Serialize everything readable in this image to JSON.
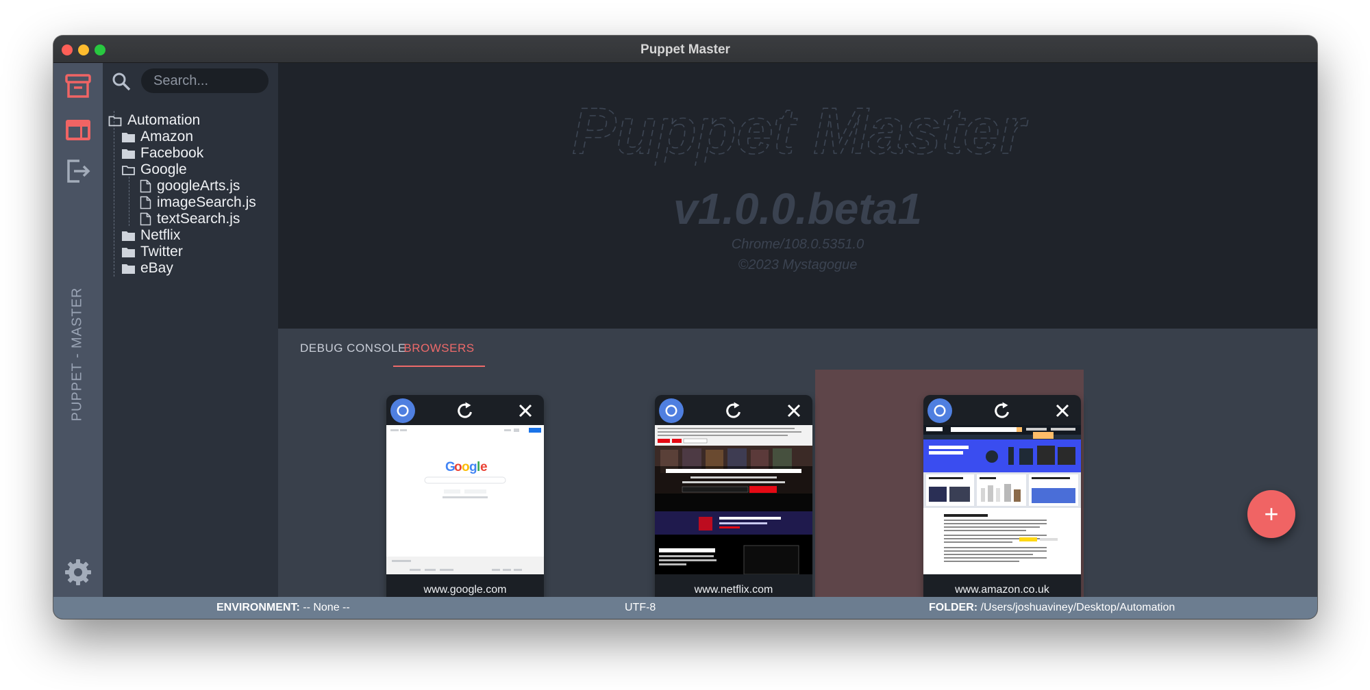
{
  "window": {
    "title": "Puppet Master"
  },
  "activity_bar": {
    "items": [
      {
        "icon": "archive-icon"
      },
      {
        "icon": "browser-layout-icon"
      },
      {
        "icon": "exit-icon"
      }
    ],
    "vertical_label": "PUPPET - MASTER",
    "settings_icon": "gear-icon"
  },
  "sidebar": {
    "search": {
      "placeholder": "Search...",
      "value": ""
    },
    "tree": {
      "root": "Automation",
      "folders": [
        "Amazon",
        "Facebook",
        "Google",
        "Netflix",
        "Twitter",
        "eBay"
      ],
      "google_files": [
        "googleArts.js",
        "imageSearch.js",
        "textSearch.js"
      ]
    }
  },
  "splash": {
    "logo_text": "Puppet Master",
    "version": "v1.0.0.beta1",
    "chrome_version": "Chrome/108.0.5351.0",
    "copyright": "©2023 Mystagogue"
  },
  "panel": {
    "tabs": [
      {
        "label": "DEBUG CONSOLE",
        "active": false
      },
      {
        "label": "BROWSERS",
        "active": true
      }
    ],
    "browsers": [
      {
        "url": "www.google.com",
        "selected": false
      },
      {
        "url": "www.netflix.com",
        "selected": false
      },
      {
        "url": "www.amazon.co.uk",
        "selected": true
      }
    ],
    "add_button": "+",
    "accent_color": "#ee6a6a"
  },
  "statusbar": {
    "environment_label": "ENVIRONMENT:",
    "environment_value": "-- None --",
    "encoding": "UTF-8",
    "folder_label": "FOLDER:",
    "folder_value": "/Users/joshuaviney/Desktop/Automation"
  }
}
